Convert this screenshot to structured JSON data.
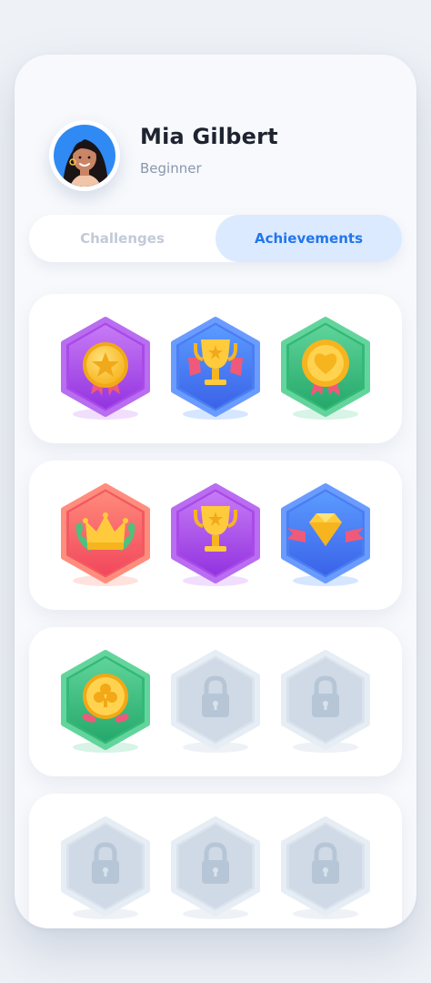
{
  "profile": {
    "name": "Mia Gilbert",
    "level": "Beginner",
    "avatar_icon": "woman-avatar-icon"
  },
  "tabs": [
    {
      "label": "Challenges",
      "active": false
    },
    {
      "label": "Achievements",
      "active": true
    }
  ],
  "colors": {
    "accent": "#2376ea",
    "active_tab_bg": "#dbeaff",
    "locked": "#cfdbe8"
  },
  "badges": [
    [
      {
        "icon": "star-medal-icon",
        "color": "purple",
        "locked": false
      },
      {
        "icon": "trophy-ribbon-icon",
        "color": "blue",
        "locked": false
      },
      {
        "icon": "heart-rosette-icon",
        "color": "green",
        "locked": false
      }
    ],
    [
      {
        "icon": "laurel-crown-icon",
        "color": "red",
        "locked": false
      },
      {
        "icon": "trophy-icon",
        "color": "purple",
        "locked": false
      },
      {
        "icon": "diamond-ribbon-icon",
        "color": "blue",
        "locked": false
      }
    ],
    [
      {
        "icon": "clover-medal-icon",
        "color": "green",
        "locked": false
      },
      {
        "icon": "lock-icon",
        "color": "gray",
        "locked": true
      },
      {
        "icon": "lock-icon",
        "color": "gray",
        "locked": true
      }
    ],
    [
      {
        "icon": "lock-icon",
        "color": "gray",
        "locked": true
      },
      {
        "icon": "lock-icon",
        "color": "gray",
        "locked": true
      },
      {
        "icon": "lock-icon",
        "color": "gray",
        "locked": true
      }
    ]
  ]
}
